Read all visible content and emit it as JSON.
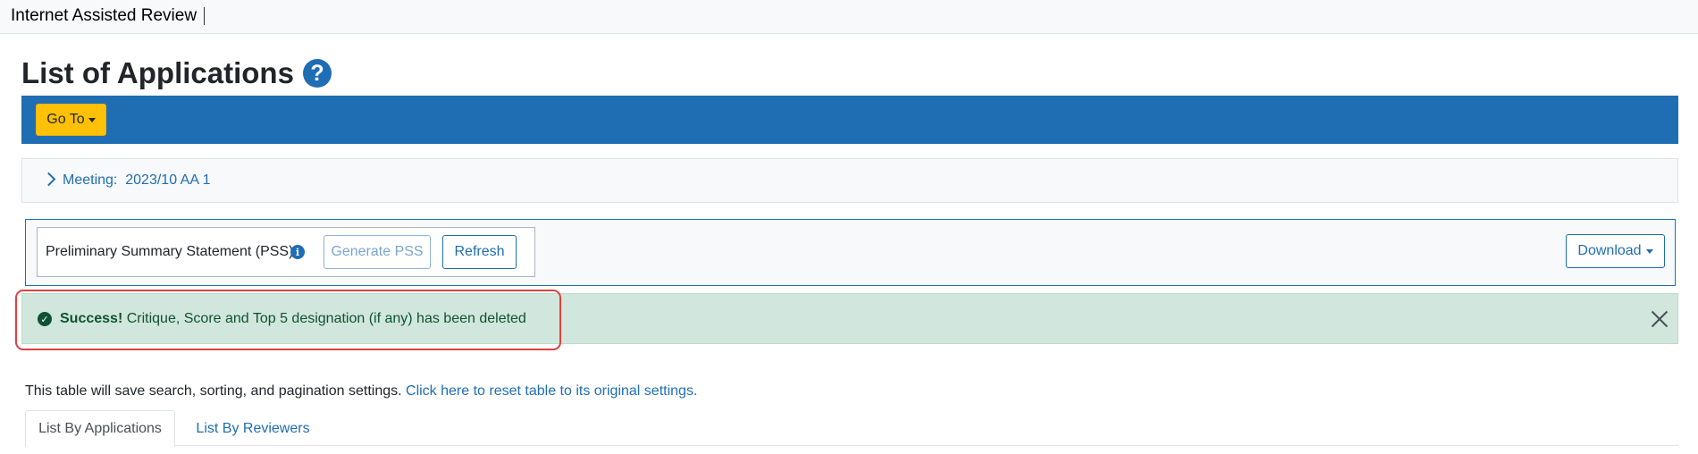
{
  "app": {
    "title": "Internet Assisted Review"
  },
  "page": {
    "title": "List of Applications",
    "help_icon": "question-circle-icon"
  },
  "action_bar": {
    "goto_label": "Go To",
    "bg_color": "#1f6db3",
    "goto_color": "#ffc107"
  },
  "meeting": {
    "label": "Meeting:  2023/10 AA 1"
  },
  "pss": {
    "label": "Preliminary Summary Statement (PSS)",
    "info_icon": "i",
    "generate_label": "Generate PSS",
    "refresh_label": "Refresh",
    "download_label": "Download"
  },
  "alert": {
    "strong": "Success!",
    "message": "Critique, Score and Top 5 designation (if any) has been deleted",
    "icon": "check-circle-icon",
    "bg_color": "#d1e7dd"
  },
  "table_note": {
    "text": "This table will save search, sorting, and pagination settings.",
    "link": "Click here to reset table to its original settings."
  },
  "tabs": [
    {
      "label": "List By Applications",
      "active": true
    },
    {
      "label": "List By Reviewers",
      "active": false
    }
  ]
}
